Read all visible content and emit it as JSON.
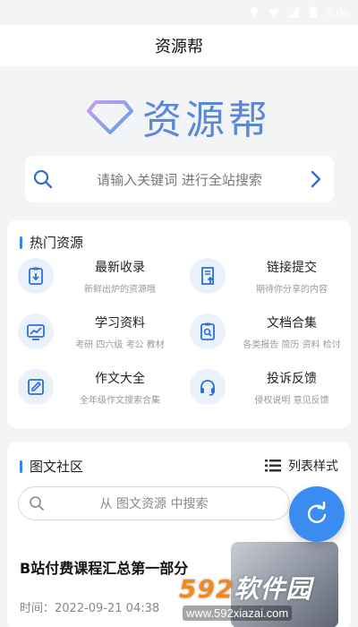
{
  "status_bar": {
    "time": "6:06"
  },
  "header": {
    "title": "资源帮"
  },
  "logo": {
    "text": "资源帮"
  },
  "search": {
    "placeholder": "请输入关键词 进行全站搜索"
  },
  "hot": {
    "title": "热门资源",
    "items": [
      {
        "title": "最新收录",
        "subtitle": "新鲜出炉的资源哦",
        "icon": "clipboard-download-icon"
      },
      {
        "title": "链接提交",
        "subtitle": "期待你分享的内容",
        "icon": "upload-document-icon"
      },
      {
        "title": "学习资料",
        "subtitle": "考研 四六级 考公 教材",
        "icon": "chart-board-icon"
      },
      {
        "title": "文档合集",
        "subtitle": "各类报告 简历 资料 检讨",
        "icon": "document-search-icon"
      },
      {
        "title": "作文大全",
        "subtitle": "全年级作文搜索合集",
        "icon": "edit-pencil-icon"
      },
      {
        "title": "投诉反馈",
        "subtitle": "侵权说明 意见反馈",
        "icon": "headset-icon"
      }
    ]
  },
  "community": {
    "title": "图文社区",
    "list_toggle": "列表样式",
    "search_placeholder": "从 图文资源 中搜索",
    "article": {
      "title": "B站付费课程汇总第一部分",
      "time": "时间：2022-09-21 04:38"
    }
  },
  "watermark": {
    "brand_number": "592",
    "brand_text": "软件园",
    "url": "www.592xiazai.com"
  },
  "colors": {
    "accent": "#3b8cf0",
    "icon_bg": "#eaf1fb",
    "logo": "#5a88d8"
  }
}
